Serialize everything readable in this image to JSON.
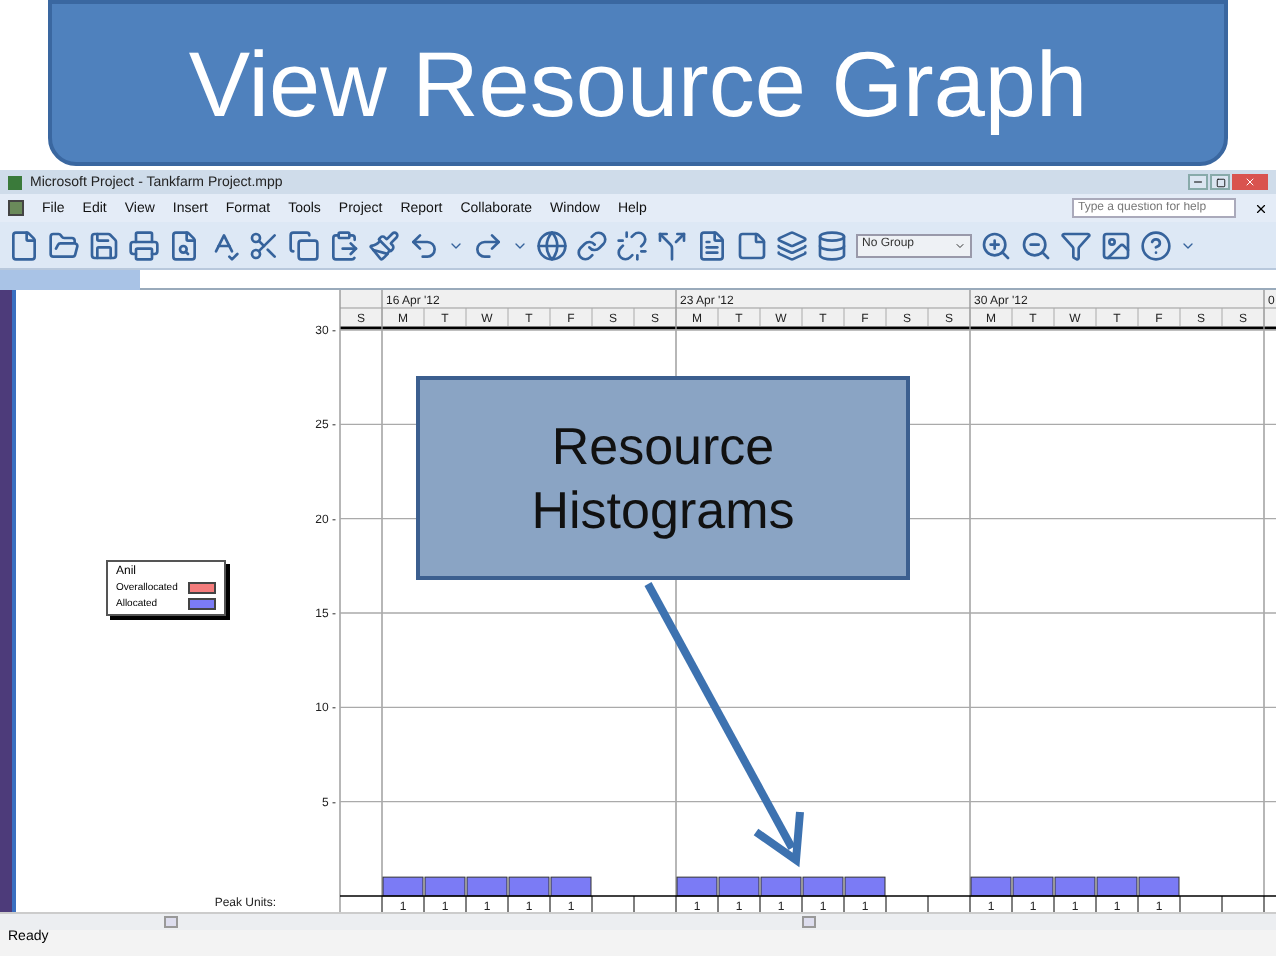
{
  "slide_title": "View Resource Graph",
  "window": {
    "title": "Microsoft Project - Tankfarm Project.mpp"
  },
  "menu": [
    "File",
    "Edit",
    "View",
    "Insert",
    "Format",
    "Tools",
    "Project",
    "Report",
    "Collaborate",
    "Window",
    "Help"
  ],
  "help_box": {
    "placeholder": "Type a question for help"
  },
  "group_dropdown": {
    "value": "No Group"
  },
  "legend": {
    "resource": "Anil",
    "items": [
      {
        "label": "Overallocated",
        "color": "#f47c7c"
      },
      {
        "label": "Allocated",
        "color": "#7b7bf5"
      }
    ]
  },
  "weeks": [
    "16 Apr '12",
    "23 Apr '12",
    "30 Apr '12",
    "0"
  ],
  "chart_data": {
    "type": "bar",
    "categories": [
      "S",
      "M",
      "T",
      "W",
      "T",
      "F",
      "S",
      "S",
      "M",
      "T",
      "W",
      "T",
      "F",
      "S",
      "S",
      "M",
      "T",
      "W",
      "T",
      "F",
      "S",
      "S"
    ],
    "values": [
      null,
      1,
      1,
      1,
      1,
      1,
      null,
      null,
      1,
      1,
      1,
      1,
      1,
      null,
      null,
      1,
      1,
      1,
      1,
      1,
      null,
      null
    ],
    "ylim": [
      0,
      30
    ],
    "grid": true,
    "yticks": [
      {
        "value": 5,
        "label": "5 -"
      },
      {
        "value": 10,
        "label": "10 -"
      },
      {
        "value": 15,
        "label": "15 -"
      },
      {
        "value": 20,
        "label": "20 -"
      },
      {
        "value": 25,
        "label": "25 -"
      },
      {
        "value": 30,
        "label": "30 -"
      }
    ]
  },
  "peak_units": {
    "label": "Peak Units:",
    "weeks": [
      [
        "1",
        "1",
        "1",
        "1",
        "1"
      ],
      [
        "1",
        "1",
        "1",
        "1",
        "1"
      ],
      [
        "1",
        "1",
        "1",
        "1",
        "1"
      ]
    ]
  },
  "callout": "Resource Histograms",
  "status_bar": "Ready"
}
